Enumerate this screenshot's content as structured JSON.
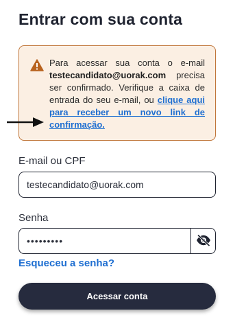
{
  "page": {
    "title": "Entrar com sua conta"
  },
  "alert": {
    "text_before": "Para acessar sua conta o e-mail ",
    "email": "testecandidato@uorak.com",
    "text_after": " precisa ser confirmado. Verifique a caixa de entrada do seu e-mail, ou ",
    "link_label": "clique aqui para receber um novo link de confirmação.",
    "icon": "warning-icon",
    "accent_color": "#c0763a",
    "background_color": "#fbefe3"
  },
  "form": {
    "email_label": "E-mail ou CPF",
    "email_value": "testecandidato@uorak.com",
    "password_label": "Senha",
    "password_value": "•••••••••",
    "toggle_visibility_icon": "eye-off-icon",
    "forgot_label": "Esqueceu a senha?",
    "submit_label": "Acessar conta"
  },
  "colors": {
    "primary_button": "#262b3e",
    "link": "#1f6fd1"
  }
}
